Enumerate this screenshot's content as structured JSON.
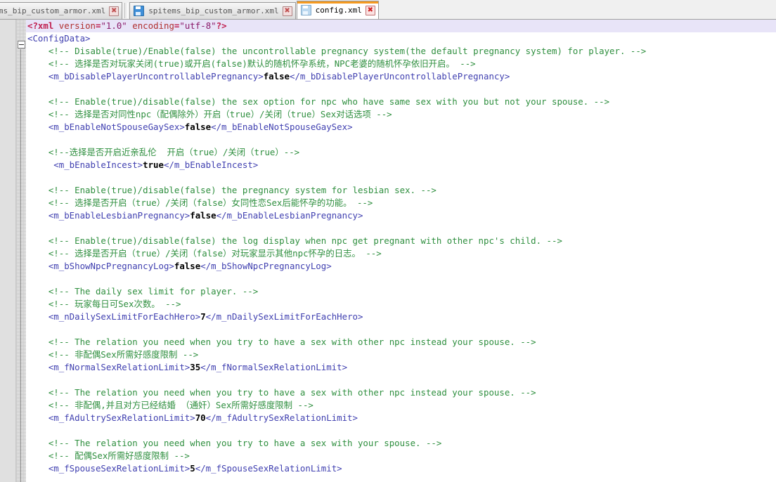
{
  "window": {
    "app": "text-editor",
    "accent_color": "#f59a1f",
    "gutter_color": "#e0e0e0",
    "comment_color": "#2f8f3f",
    "tag_color": "#4040b0",
    "value_color": "#000000",
    "current_line_color": "#e8e4f8"
  },
  "tabs": [
    {
      "label": "items_bip_custom_armor.xml",
      "icon": "save-icon",
      "close": "✖",
      "active": false,
      "clipped": true
    },
    {
      "label": "spitems_bip_custom_armor.xml",
      "icon": "save-icon",
      "close": "✖",
      "active": false,
      "clipped": false
    },
    {
      "label": "config.xml",
      "icon": "save-icon",
      "close": "✖",
      "active": true,
      "clipped": false
    }
  ],
  "fold": {
    "box_glyph": "−",
    "node": "ConfigData"
  },
  "code": {
    "lines": [
      {
        "indent": 0,
        "highlight": true,
        "tokens": [
          {
            "t": "pi",
            "s": "<?xml "
          },
          {
            "t": "piattr",
            "s": "version"
          },
          {
            "t": "pi",
            "s": "="
          },
          {
            "t": "pistr",
            "s": "\"1.0\""
          },
          {
            "t": "pi",
            "s": " "
          },
          {
            "t": "piattr",
            "s": "encoding"
          },
          {
            "t": "pi",
            "s": "="
          },
          {
            "t": "pistr",
            "s": "\"utf-8\""
          },
          {
            "t": "pi",
            "s": "?>"
          }
        ]
      },
      {
        "indent": 0,
        "highlight": false,
        "tokens": [
          {
            "t": "tagbr",
            "s": "<ConfigData>"
          }
        ]
      },
      {
        "indent": 4,
        "highlight": false,
        "tokens": [
          {
            "t": "cmt",
            "s": "<!-- Disable(true)/Enable(false) the uncontrollable pregnancy system(the default pregnancy system) for player. -->"
          }
        ]
      },
      {
        "indent": 4,
        "highlight": false,
        "tokens": [
          {
            "t": "cmt",
            "s": "<!-- 选择是否对玩家关闭(true)或开启(false)默认的随机怀孕系统，NPC老婆的随机怀孕依旧开启。 -->"
          }
        ]
      },
      {
        "indent": 4,
        "highlight": false,
        "tokens": [
          {
            "t": "tagnm",
            "s": "<m_bDisablePlayerUncontrollablePregnancy>"
          },
          {
            "t": "val",
            "s": "false"
          },
          {
            "t": "tagnm",
            "s": "</m_bDisablePlayerUncontrollablePregnancy>"
          }
        ]
      },
      {
        "indent": 0,
        "highlight": false,
        "tokens": []
      },
      {
        "indent": 4,
        "highlight": false,
        "tokens": [
          {
            "t": "cmt",
            "s": "<!-- Enable(true)/disable(false) the sex option for npc who have same sex with you but not your spouse. -->"
          }
        ]
      },
      {
        "indent": 4,
        "highlight": false,
        "tokens": [
          {
            "t": "cmt",
            "s": "<!-- 选择是否对同性npc（配偶除外）开启（true）/关闭（true）Sex对话选项 -->"
          }
        ]
      },
      {
        "indent": 4,
        "highlight": false,
        "tokens": [
          {
            "t": "tagnm",
            "s": "<m_bEnableNotSpouseGaySex>"
          },
          {
            "t": "val",
            "s": "false"
          },
          {
            "t": "tagnm",
            "s": "</m_bEnableNotSpouseGaySex>"
          }
        ]
      },
      {
        "indent": 0,
        "highlight": false,
        "tokens": []
      },
      {
        "indent": 4,
        "highlight": false,
        "tokens": [
          {
            "t": "cmt",
            "s": "<!--选择是否开启近亲乱伦  开启（true）/关闭（true）-->"
          }
        ]
      },
      {
        "indent": 5,
        "highlight": false,
        "tokens": [
          {
            "t": "tagnm",
            "s": "<m_bEnableIncest>"
          },
          {
            "t": "val",
            "s": "true"
          },
          {
            "t": "tagnm",
            "s": "</m_bEnableIncest>"
          }
        ]
      },
      {
        "indent": 0,
        "highlight": false,
        "tokens": []
      },
      {
        "indent": 4,
        "highlight": false,
        "tokens": [
          {
            "t": "cmt",
            "s": "<!-- Enable(true)/disable(false) the pregnancy system for lesbian sex. -->"
          }
        ]
      },
      {
        "indent": 4,
        "highlight": false,
        "tokens": [
          {
            "t": "cmt",
            "s": "<!-- 选择是否开启（true）/关闭（false）女同性恋Sex后能怀孕的功能。 -->"
          }
        ]
      },
      {
        "indent": 4,
        "highlight": false,
        "tokens": [
          {
            "t": "tagnm",
            "s": "<m_bEnableLesbianPregnancy>"
          },
          {
            "t": "val",
            "s": "false"
          },
          {
            "t": "tagnm",
            "s": "</m_bEnableLesbianPregnancy>"
          }
        ]
      },
      {
        "indent": 0,
        "highlight": false,
        "tokens": []
      },
      {
        "indent": 4,
        "highlight": false,
        "tokens": [
          {
            "t": "cmt",
            "s": "<!-- Enable(true)/disable(false) the log display when npc get pregnant with other npc's child. -->"
          }
        ]
      },
      {
        "indent": 4,
        "highlight": false,
        "tokens": [
          {
            "t": "cmt",
            "s": "<!-- 选择是否开启（true）/关闭（false）对玩家显示其他npc怀孕的日志。 -->"
          }
        ]
      },
      {
        "indent": 4,
        "highlight": false,
        "tokens": [
          {
            "t": "tagnm",
            "s": "<m_bShowNpcPregnancyLog>"
          },
          {
            "t": "val",
            "s": "false"
          },
          {
            "t": "tagnm",
            "s": "</m_bShowNpcPregnancyLog>"
          }
        ]
      },
      {
        "indent": 0,
        "highlight": false,
        "tokens": []
      },
      {
        "indent": 4,
        "highlight": false,
        "tokens": [
          {
            "t": "cmt",
            "s": "<!-- The daily sex limit for player. -->"
          }
        ]
      },
      {
        "indent": 4,
        "highlight": false,
        "tokens": [
          {
            "t": "cmt",
            "s": "<!-- 玩家每日可Sex次数。 -->"
          }
        ]
      },
      {
        "indent": 4,
        "highlight": false,
        "tokens": [
          {
            "t": "tagnm",
            "s": "<m_nDailySexLimitForEachHero>"
          },
          {
            "t": "val",
            "s": "7"
          },
          {
            "t": "tagnm",
            "s": "</m_nDailySexLimitForEachHero>"
          }
        ]
      },
      {
        "indent": 0,
        "highlight": false,
        "tokens": []
      },
      {
        "indent": 4,
        "highlight": false,
        "tokens": [
          {
            "t": "cmt",
            "s": "<!-- The relation you need when you try to have a sex with other npc instead your spouse. -->"
          }
        ]
      },
      {
        "indent": 4,
        "highlight": false,
        "tokens": [
          {
            "t": "cmt",
            "s": "<!-- 非配偶Sex所需好感度限制 -->"
          }
        ]
      },
      {
        "indent": 4,
        "highlight": false,
        "tokens": [
          {
            "t": "tagnm",
            "s": "<m_fNormalSexRelationLimit>"
          },
          {
            "t": "val",
            "s": "35"
          },
          {
            "t": "tagnm",
            "s": "</m_fNormalSexRelationLimit>"
          }
        ]
      },
      {
        "indent": 0,
        "highlight": false,
        "tokens": []
      },
      {
        "indent": 4,
        "highlight": false,
        "tokens": [
          {
            "t": "cmt",
            "s": "<!-- The relation you need when you try to have a sex with other npc instead your spouse. -->"
          }
        ]
      },
      {
        "indent": 4,
        "highlight": false,
        "tokens": [
          {
            "t": "cmt",
            "s": "<!-- 非配偶,并且对方已经结婚 （通奸）Sex所需好感度限制 -->"
          }
        ]
      },
      {
        "indent": 4,
        "highlight": false,
        "tokens": [
          {
            "t": "tagnm",
            "s": "<m_fAdultrySexRelationLimit>"
          },
          {
            "t": "val",
            "s": "70"
          },
          {
            "t": "tagnm",
            "s": "</m_fAdultrySexRelationLimit>"
          }
        ]
      },
      {
        "indent": 0,
        "highlight": false,
        "tokens": []
      },
      {
        "indent": 4,
        "highlight": false,
        "tokens": [
          {
            "t": "cmt",
            "s": "<!-- The relation you need when you try to have a sex with your spouse. -->"
          }
        ]
      },
      {
        "indent": 4,
        "highlight": false,
        "tokens": [
          {
            "t": "cmt",
            "s": "<!-- 配偶Sex所需好感度限制 -->"
          }
        ]
      },
      {
        "indent": 4,
        "highlight": false,
        "tokens": [
          {
            "t": "tagnm",
            "s": "<m_fSpouseSexRelationLimit>"
          },
          {
            "t": "val",
            "s": "5"
          },
          {
            "t": "tagnm",
            "s": "</m_fSpouseSexRelationLimit>"
          }
        ]
      }
    ]
  }
}
